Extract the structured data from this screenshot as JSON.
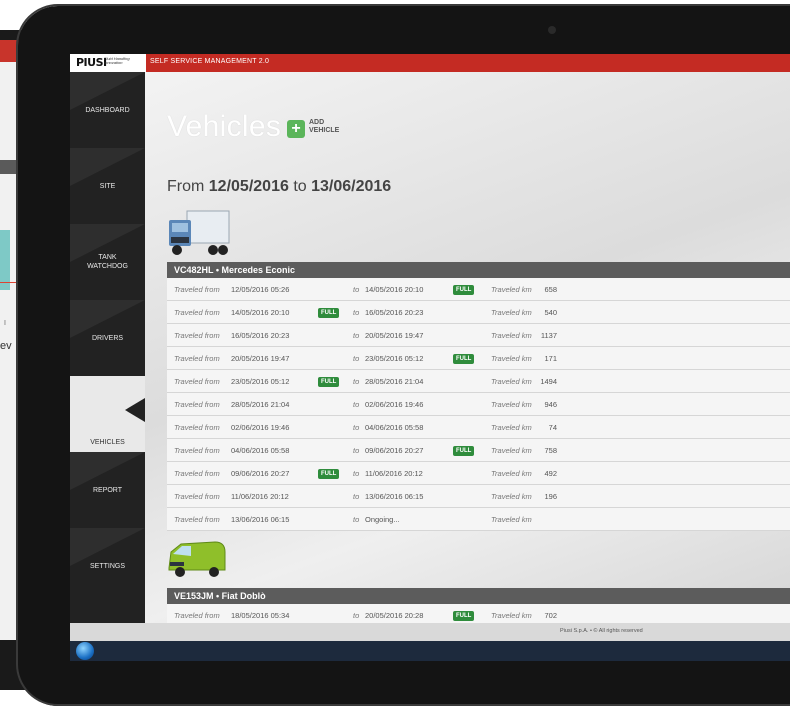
{
  "app": {
    "logo": "PIUSI",
    "logo_tagline": "Fluid Handling Innovation",
    "title": "SELF SERVICE MANAGEMENT 2.0"
  },
  "background_device": {
    "partial_text": "ev",
    "partial_text2": "I"
  },
  "sidebar": {
    "items": [
      {
        "label": "DASHBOARD"
      },
      {
        "label": "SITE"
      },
      {
        "label": "TANK WATCHDOG"
      },
      {
        "label": "DRIVERS"
      },
      {
        "label": "VEHICLES",
        "active": true
      },
      {
        "label": "REPORT"
      },
      {
        "label": "SETTINGS"
      }
    ]
  },
  "page": {
    "title": "Vehicles",
    "add_label_1": "ADD",
    "add_label_2": "VEHICLE",
    "range_prefix": "From",
    "range_from": "12/05/2016",
    "range_mid": "to",
    "range_to": "13/06/2016"
  },
  "row_labels": {
    "from": "Traveled from",
    "to": "to",
    "km": "Traveled km",
    "full": "FULL"
  },
  "vehicles": [
    {
      "header": "VC482HL • Mercedes Econic",
      "icon": "truck-icon",
      "rows": [
        {
          "from": "12/05/2016 05:26",
          "from_full": false,
          "to": "14/05/2016 20:10",
          "to_full": true,
          "km": "658"
        },
        {
          "from": "14/05/2016 20:10",
          "from_full": true,
          "to": "16/05/2016 20:23",
          "to_full": false,
          "km": "540"
        },
        {
          "from": "16/05/2016 20:23",
          "from_full": false,
          "to": "20/05/2016 19:47",
          "to_full": false,
          "km": "1137"
        },
        {
          "from": "20/05/2016 19:47",
          "from_full": false,
          "to": "23/05/2016 05:12",
          "to_full": true,
          "km": "171"
        },
        {
          "from": "23/05/2016 05:12",
          "from_full": true,
          "to": "28/05/2016 21:04",
          "to_full": false,
          "km": "1494"
        },
        {
          "from": "28/05/2016 21:04",
          "from_full": false,
          "to": "02/06/2016 19:46",
          "to_full": false,
          "km": "946"
        },
        {
          "from": "02/06/2016 19:46",
          "from_full": false,
          "to": "04/06/2016 05:58",
          "to_full": false,
          "km": "74"
        },
        {
          "from": "04/06/2016 05:58",
          "from_full": false,
          "to": "09/06/2016 20:27",
          "to_full": true,
          "km": "758"
        },
        {
          "from": "09/06/2016 20:27",
          "from_full": true,
          "to": "11/06/2016 20:12",
          "to_full": false,
          "km": "492"
        },
        {
          "from": "11/06/2016 20:12",
          "from_full": false,
          "to": "13/06/2016 06:15",
          "to_full": false,
          "km": "196"
        },
        {
          "from": "13/06/2016 06:15",
          "from_full": false,
          "to": "Ongoing...",
          "to_full": false,
          "km": ""
        }
      ]
    },
    {
      "header": "VE153JM • Fiat Doblò",
      "icon": "van-icon",
      "rows": [
        {
          "from": "18/05/2016 05:34",
          "from_full": false,
          "to": "20/05/2016 20:28",
          "to_full": true,
          "km": "702"
        }
      ]
    }
  ],
  "footer": {
    "text": "Piusi S.p.A. • © All rights reserved"
  },
  "colors": {
    "brand_red": "#c42b23",
    "full_green": "#2f8c3c",
    "add_green": "#5bb55a",
    "sidebar": "#222222"
  }
}
